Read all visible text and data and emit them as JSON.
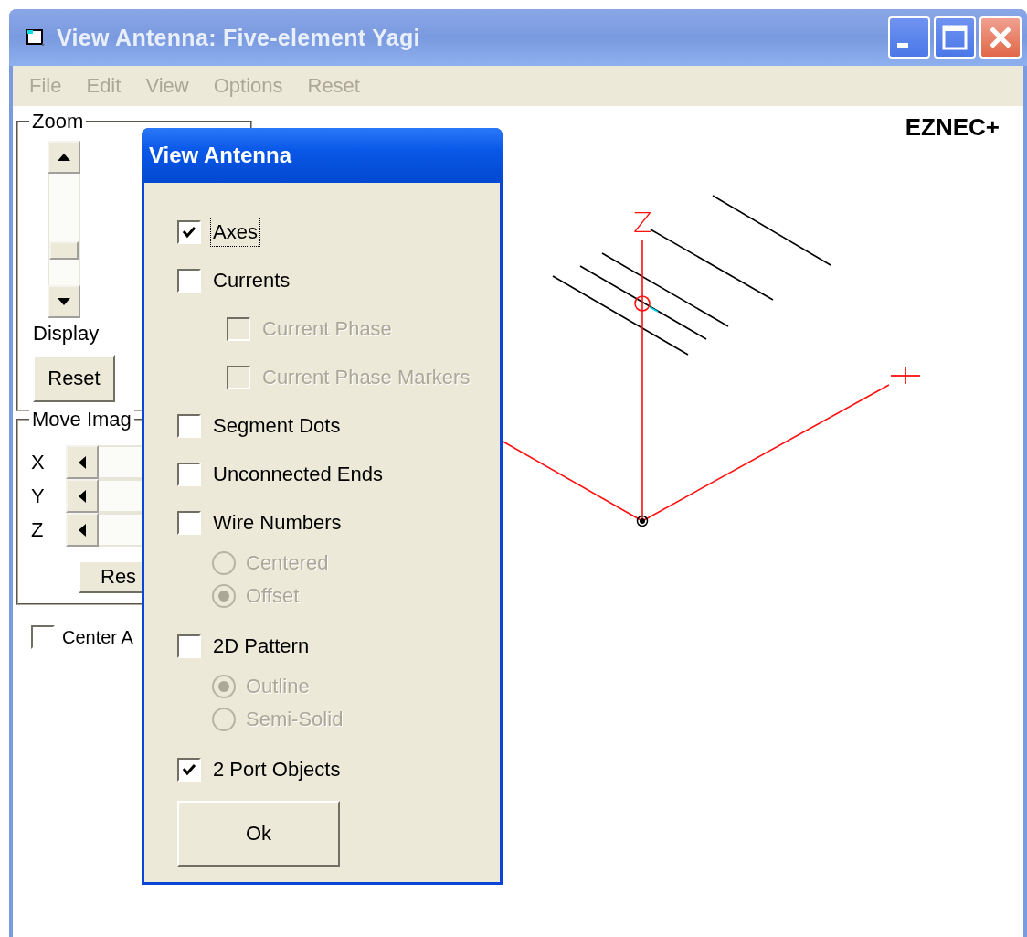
{
  "window": {
    "title": "View Antenna: Five-element Yagi",
    "active": false
  },
  "menu": [
    {
      "label": "File",
      "disabled": true
    },
    {
      "label": "Edit",
      "disabled": true
    },
    {
      "label": "View",
      "disabled": true
    },
    {
      "label": "Options",
      "disabled": true
    },
    {
      "label": "Reset",
      "disabled": true
    }
  ],
  "zoom_group": {
    "title": "Zoom",
    "display_label": "Display",
    "reset_button": "Reset"
  },
  "move_group": {
    "title": "Move Imag",
    "rows": [
      {
        "label": "X"
      },
      {
        "label": "Y"
      },
      {
        "label": "Z"
      }
    ],
    "reset_button": "Res"
  },
  "center_checkbox": {
    "label": "Center A",
    "checked": false
  },
  "canvas": {
    "brand": "EZNEC+",
    "axis_label": "Z"
  },
  "dialog": {
    "title": "View Antenna",
    "ok_button": "Ok",
    "options": [
      {
        "kind": "checkbox",
        "label": "Axes",
        "checked": true,
        "disabled": false,
        "focused": true
      },
      {
        "kind": "checkbox",
        "label": "Currents",
        "checked": false,
        "disabled": false,
        "children": [
          {
            "kind": "checkbox",
            "label": "Current Phase",
            "checked": false,
            "disabled": true
          },
          {
            "kind": "checkbox",
            "label": "Current Phase Markers",
            "checked": false,
            "disabled": true
          }
        ]
      },
      {
        "kind": "checkbox",
        "label": "Segment Dots",
        "checked": false,
        "disabled": false
      },
      {
        "kind": "checkbox",
        "label": "Unconnected Ends",
        "checked": false,
        "disabled": false
      },
      {
        "kind": "checkbox",
        "label": "Wire Numbers",
        "checked": false,
        "disabled": false,
        "children": [
          {
            "kind": "radio",
            "label": "Centered",
            "selected": false,
            "disabled": true
          },
          {
            "kind": "radio",
            "label": "Offset",
            "selected": true,
            "disabled": true
          }
        ]
      },
      {
        "kind": "checkbox",
        "label": "2D Pattern",
        "checked": false,
        "disabled": false,
        "children": [
          {
            "kind": "radio",
            "label": "Outline",
            "selected": true,
            "disabled": true
          },
          {
            "kind": "radio",
            "label": "Semi-Solid",
            "selected": false,
            "disabled": true
          }
        ]
      },
      {
        "kind": "checkbox",
        "label": "2 Port Objects",
        "checked": true,
        "disabled": false
      }
    ]
  }
}
